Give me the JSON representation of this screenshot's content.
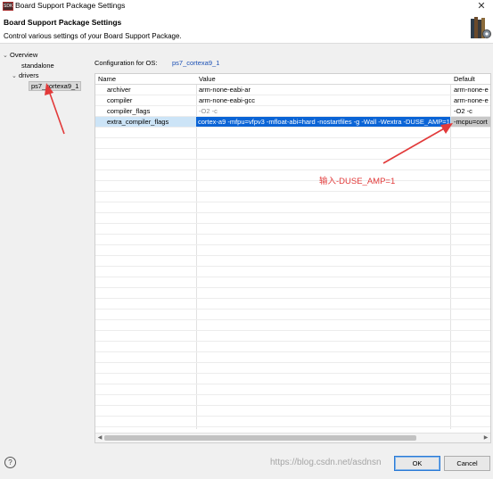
{
  "window": {
    "title": "Board Support Package Settings",
    "close_glyph": "✕"
  },
  "header": {
    "title": "Board Support Package Settings",
    "description": "Control various settings of your Board Support Package."
  },
  "tree": {
    "items": [
      {
        "label": "Overview",
        "arrow": "⌄"
      },
      {
        "label": "standalone"
      },
      {
        "label": "drivers",
        "arrow": "⌄"
      },
      {
        "label": "ps7_cortexa9_1"
      }
    ]
  },
  "config": {
    "label": "Configuration for OS:",
    "value": "ps7_cortexa9_1"
  },
  "table": {
    "headers": {
      "name": "Name",
      "value": "Value",
      "default": "Default"
    },
    "rows": [
      {
        "name": "archiver",
        "value": "arm-none-eabi-ar",
        "default": "arm-none-e"
      },
      {
        "name": "compiler",
        "value": "arm-none-eabi-gcc",
        "default": "arm-none-e"
      },
      {
        "name": "compiler_flags",
        "value": "-O2 -c",
        "default": "-O2 -c"
      },
      {
        "name": "extra_compiler_flags",
        "value": "cortex-a9 -mfpu=vfpv3 -mfloat-abi=hard -nostartfiles -g -Wall -Wextra -DUSE_AMP=1",
        "default": "-mcpu=cort"
      }
    ]
  },
  "annotation": {
    "text": "输入-DUSE_AMP=1",
    "color": "#e23a3a"
  },
  "buttons": {
    "help": "?",
    "ok": "OK",
    "cancel": "Cancel"
  },
  "watermark": "https://blog.csdn.net/asdnsn"
}
